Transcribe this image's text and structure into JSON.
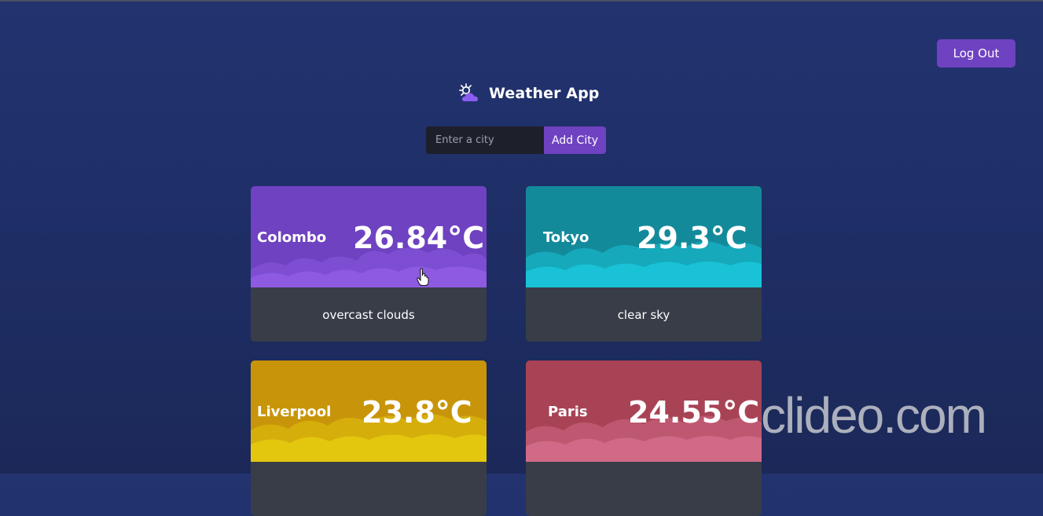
{
  "app": {
    "title": "Weather App",
    "icon": "partly-cloudy-icon"
  },
  "toolbar": {
    "logout_label": "Log Out"
  },
  "search": {
    "placeholder": "Enter a city",
    "value": "",
    "add_label": "Add City"
  },
  "cards": [
    {
      "city": "Colombo",
      "temp": "26.84°C",
      "description": "overcast clouds",
      "color_top": "#6f42c1",
      "color_bottom": "#8e5ae0"
    },
    {
      "city": "Tokyo",
      "temp": "29.3°C",
      "description": "clear sky",
      "color_top": "#138a9a",
      "color_bottom": "#19c2d6"
    },
    {
      "city": "Liverpool",
      "temp": "23.8°C",
      "description": "",
      "color_top": "#c8950a",
      "color_bottom": "#e3c70e"
    },
    {
      "city": "Paris",
      "temp": "24.55°C",
      "description": "",
      "color_top": "#a84355",
      "color_bottom": "#d06a86"
    }
  ],
  "watermark": "clideo.com"
}
